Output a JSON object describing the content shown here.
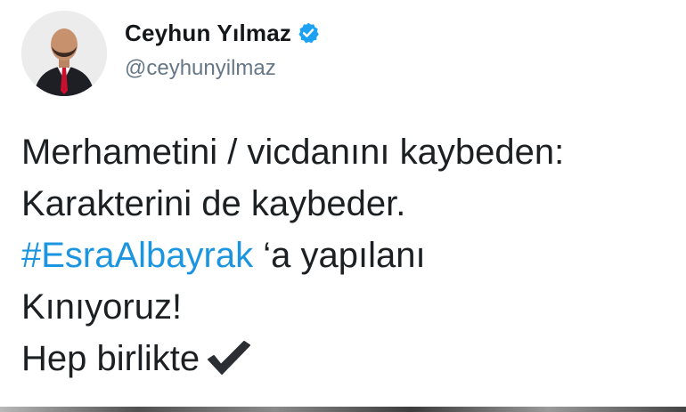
{
  "tweet": {
    "author": {
      "display_name": "Ceyhun Yılmaz",
      "handle": "@ceyhunyilmaz",
      "verified": true,
      "avatar_icon": "profile-photo"
    },
    "text": {
      "line1": "Merhametini / vicdanını kaybeden:",
      "line2": "Karakterini de kaybeder.",
      "line3_hashtag": "#EsraAlbayrak",
      "line3_rest": " ‘a yapılanı",
      "line4": "Kınıyoruz!",
      "line5": "Hep birlikte",
      "line5_icon": "heavy-check-mark-icon"
    }
  },
  "colors": {
    "text": "#1c2022",
    "handle": "#657786",
    "link": "#1b95e0",
    "verified": "#1da1f2"
  }
}
